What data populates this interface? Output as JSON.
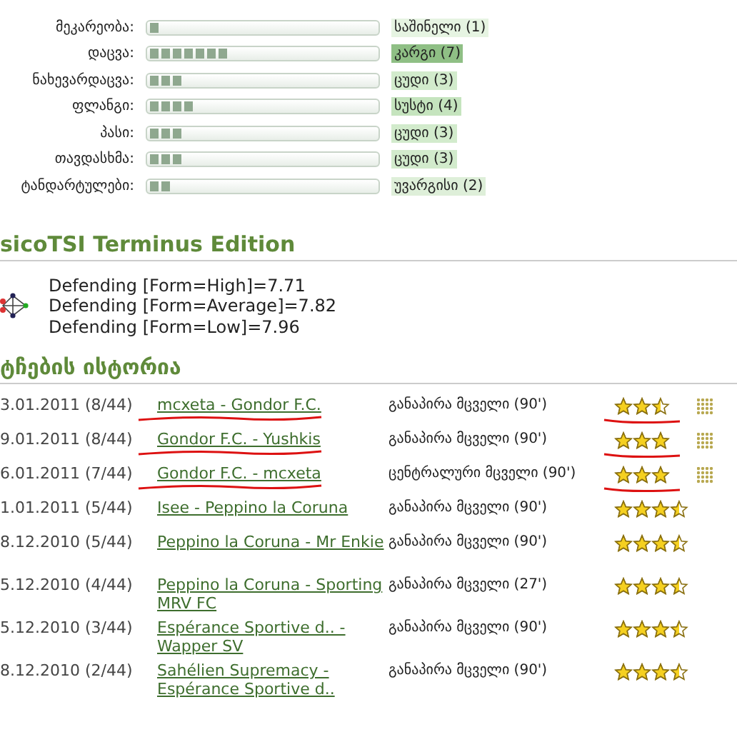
{
  "skills": [
    {
      "label": "მეკარეობა:",
      "level": 0.05,
      "rating": "საშინელი (1)",
      "color": "#e6f4e2"
    },
    {
      "label": "დაცვა:",
      "level": 0.35,
      "rating": "კარგი (7)",
      "color": "#8fbf85"
    },
    {
      "label": "ნახევარდაცვა:",
      "level": 0.15,
      "rating": "ცუდი (3)",
      "color": "#d2ebcc"
    },
    {
      "label": "ფლანგი:",
      "level": 0.2,
      "rating": "სუსტი (4)",
      "color": "#c5e4be"
    },
    {
      "label": "პასი:",
      "level": 0.15,
      "rating": "ცუდი (3)",
      "color": "#d2ebcc"
    },
    {
      "label": "თავდასხმა:",
      "level": 0.15,
      "rating": "ცუდი (3)",
      "color": "#d2ebcc"
    },
    {
      "label": "ტანდარტულები:",
      "level": 0.1,
      "rating": "უვარგისი (2)",
      "color": "#deefd9"
    }
  ],
  "tsi": {
    "title": "sicoTSI Terminus Edition",
    "lines": [
      "Defending [Form=High]=7.71",
      "Defending [Form=Average]=7.82",
      "Defending [Form=Low]=7.96"
    ]
  },
  "history": {
    "title": "ტჩების ისტორია",
    "rows": [
      {
        "date": "3.01.2011 (8/44)",
        "match": "mcxeta - Gondor F.C.",
        "position": "განაპირა მცველი (90')",
        "stars": 2.5,
        "annotated": true,
        "details": true
      },
      {
        "date": "9.01.2011 (8/44)",
        "match": "Gondor F.C. - Yushkis",
        "position": "განაპირა მცველი (90')",
        "stars": 3,
        "annotated": true,
        "details": true
      },
      {
        "date": "6.01.2011 (7/44)",
        "match": "Gondor F.C. - mcxeta",
        "position": "ცენტრალური მცველი (90')",
        "stars": 3,
        "annotated": true,
        "details": true
      },
      {
        "date": "1.01.2011 (5/44)",
        "match": "Isee - Peppino la Coruna",
        "position": "განაპირა მცველი (90')",
        "stars": 3.5,
        "annotated": false,
        "details": false
      },
      {
        "date": "8.12.2010 (5/44)",
        "match": "Peppino la Coruna - Mr  Enkie",
        "position": "განაპირა მცველი (90')",
        "stars": 3.5,
        "annotated": false,
        "details": false
      },
      {
        "date": "5.12.2010 (4/44)",
        "match": "Peppino la Coruna - Sporting MRV FC",
        "position": "განაპირა მცველი (27')",
        "stars": 3.5,
        "annotated": false,
        "details": false
      },
      {
        "date": "5.12.2010 (3/44)",
        "match": "Espérance Sportive d.. - Wapper SV",
        "position": "განაპირა მცველი (90')",
        "stars": 3.5,
        "annotated": false,
        "details": false
      },
      {
        "date": "8.12.2010 (2/44)",
        "match": "Sahélien Supremacy - Espérance Sportive d..",
        "position": "განაპირა მცველი (90')",
        "stars": 3.5,
        "annotated": false,
        "details": false
      }
    ]
  }
}
